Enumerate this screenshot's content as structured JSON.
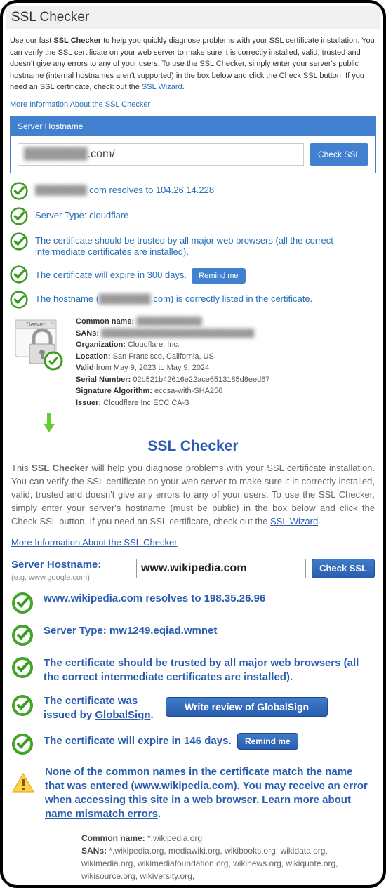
{
  "top": {
    "title": "SSL Checker",
    "intro_prefix": "Use our fast ",
    "intro_bold": "SSL Checker",
    "intro_rest": " to help you quickly diagnose problems with your SSL certificate installation. You can verify the SSL certificate on your web server to make sure it is correctly installed, valid, trusted and doesn't give any errors to any of your users. To use the SSL Checker, simply enter your server's public hostname (internal hostnames aren't supported) in the box below and click the Check SSL button. If you need an SSL certificate, check out the ",
    "intro_link": "SSL Wizard",
    "more_link": "More Information About the SSL Checker",
    "panel_header": "Server Hostname",
    "hostname_blur": "████████",
    "hostname_suffix": ".com/",
    "check_btn": "Check SSL",
    "results": {
      "r0_blur": "████████",
      "r0_rest": ".com resolves to 104.26.14.228",
      "r1": "Server Type: cloudflare",
      "r2": "The certificate should be trusted by all major web browsers (all the correct intermediate certificates are installed).",
      "r3": "The certificate will expire in 300 days.",
      "r3_btn": "Remind me",
      "r4_pre": "The hostname (",
      "r4_blur": "████████",
      "r4_post": ".com) is correctly listed in the certificate."
    },
    "details": {
      "server_label": "Server",
      "cn_label": "Common name: ",
      "cn_val": "████████████",
      "sans_label": "SANs: ",
      "sans_val": "████████████████████████████",
      "org_label": "Organization: ",
      "org_val": "Cloudflare, Inc.",
      "loc_label": "Location: ",
      "loc_val": "San Francisco, California, US",
      "valid_label": "Valid ",
      "valid_val": "from May 9, 2023 to May 9, 2024",
      "serial_label": "Serial Number: ",
      "serial_val": "02b521b42616e22ace6513185d8eed67",
      "sig_label": "Signature Algorithm: ",
      "sig_val": "ecdsa-with-SHA256",
      "issuer_label": "Issuer: ",
      "issuer_val": "Cloudflare Inc ECC CA-3"
    }
  },
  "bottom": {
    "title": "SSL Checker",
    "intro_prefix": "This ",
    "intro_bold": "SSL Checker",
    "intro_rest": " will help you diagnose problems with your SSL certificate installation. You can verify the SSL certificate on your web server to make sure it  is correctly installed, valid, trusted and doesn't give any errors to any of your users. To use the SSL Checker, simply enter your server's hostname (must be public) in the box below and click the Check SSL button. If you need an SSL certificate, check out the ",
    "intro_link": "SSL Wizard",
    "more_link": "More Information About the SSL Checker",
    "form_label": "Server Hostname:",
    "hint": "(e.g. www.google.com)",
    "hostname_value": "www.wikipedia.com",
    "check_btn": "Check SSL",
    "results": {
      "r0": "www.wikipedia.com resolves to 198.35.26.96",
      "r1": "Server Type: mw1249.eqiad.wmnet",
      "r2": "The certificate should be trusted by all major web browsers (all the correct intermediate certificates are installed).",
      "r3_pre": "The certificate was issued by ",
      "r3_link": "GlobalSign",
      "r3_post": ".",
      "r3_btn": "Write review of GlobalSign",
      "r4": "The certificate will expire in 146 days.",
      "r4_btn": "Remind me",
      "warn_pre": "None of the common names in the certificate match the name that was entered (www.wikipedia.com). You may receive an error when accessing this site in a web browser. ",
      "warn_link": "Learn more about name mismatch errors",
      "warn_post": "."
    },
    "details": {
      "cn_label": "Common name: ",
      "cn_val": "*.wikipedia.org",
      "sans_label": "SANs: ",
      "sans_val": "*.wikipedia.org, mediawiki.org, wikibooks.org, wikidata.org, wikimedia.org, wikimediafoundation.org, wikinews.org, wikiquote.org, wikisource.org, wikiversity.org,"
    }
  }
}
